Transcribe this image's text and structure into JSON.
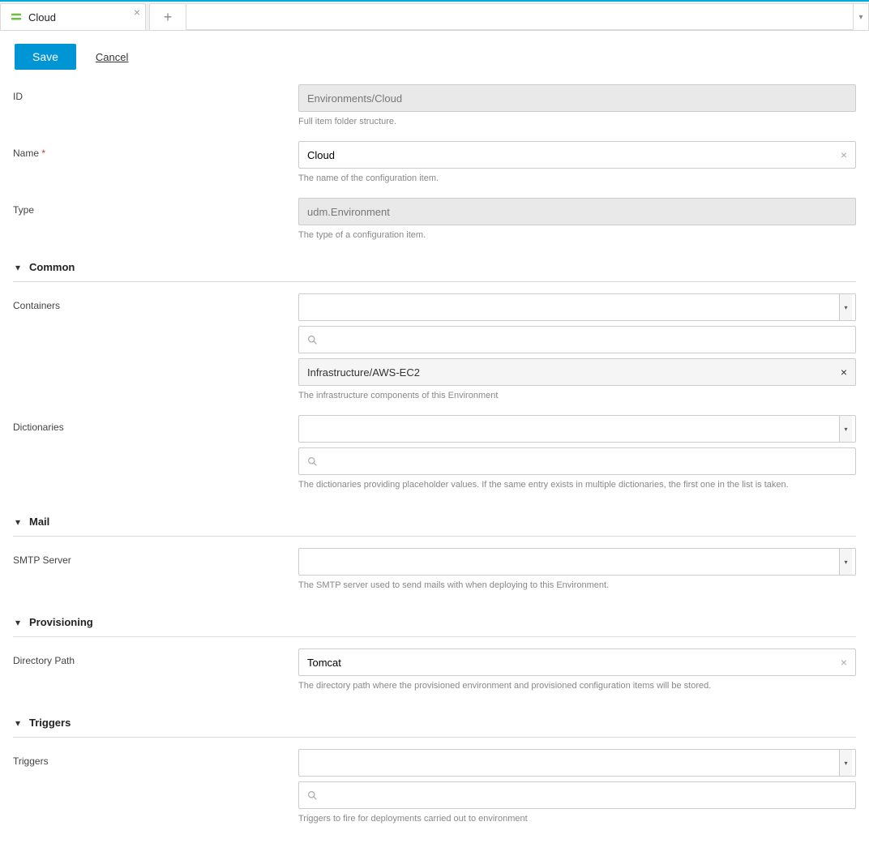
{
  "tab": {
    "title": "Cloud"
  },
  "actions": {
    "save": "Save",
    "cancel": "Cancel"
  },
  "fields": {
    "id": {
      "label": "ID",
      "value": "Environments/Cloud",
      "helper": "Full item folder structure."
    },
    "name": {
      "label": "Name",
      "value": "Cloud",
      "helper": "The name of the configuration item."
    },
    "type": {
      "label": "Type",
      "value": "udm.Environment",
      "helper": "The type of a configuration item."
    }
  },
  "sections": {
    "common": {
      "title": "Common",
      "containers": {
        "label": "Containers",
        "items": [
          "Infrastructure/AWS-EC2"
        ],
        "helper": "The infrastructure components of this Environment"
      },
      "dictionaries": {
        "label": "Dictionaries",
        "helper": "The dictionaries providing placeholder values. If the same entry exists in multiple dictionaries, the first one in the list is taken."
      }
    },
    "mail": {
      "title": "Mail",
      "smtp": {
        "label": "SMTP Server",
        "helper": "The SMTP server used to send mails with when deploying to this Environment."
      }
    },
    "provisioning": {
      "title": "Provisioning",
      "directory": {
        "label": "Directory Path",
        "value": "Tomcat",
        "helper": "The directory path where the provisioned environment and provisioned configuration items will be stored."
      }
    },
    "triggers_section": {
      "title": "Triggers",
      "triggers": {
        "label": "Triggers",
        "helper": "Triggers to fire for deployments carried out to environment"
      }
    }
  }
}
